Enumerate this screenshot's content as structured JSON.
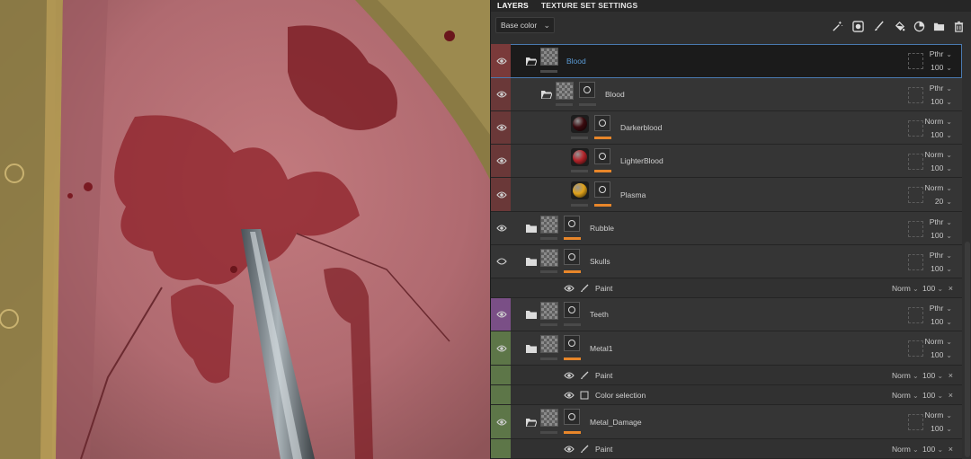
{
  "tabs": [
    "LAYERS",
    "TEXTURE SET SETTINGS"
  ],
  "toolbar": {
    "channel_select": "Base color",
    "icons": [
      "magic-wand-icon",
      "mask-icon",
      "brush-icon",
      "fill-icon",
      "smart-material-icon",
      "folder-icon",
      "trash-icon"
    ]
  },
  "colors": {
    "blood_group": "#7a3a3a",
    "blood_child": "#6a3838",
    "teeth": "#7a4f86",
    "metal": "#5d7648",
    "accent_orange": "#e8862a",
    "selection_text": "#5b9bd5"
  },
  "layers": [
    {
      "name": "Blood",
      "blend": "Pthr",
      "opacity": "100",
      "selected": true
    },
    {
      "name": "Blood",
      "blend": "Pthr",
      "opacity": "100"
    },
    {
      "name": "Darkerblood",
      "blend": "Norm",
      "opacity": "100"
    },
    {
      "name": "LighterBlood",
      "blend": "Norm",
      "opacity": "100"
    },
    {
      "name": "Plasma",
      "blend": "Norm",
      "opacity": "20"
    },
    {
      "name": "Rubble",
      "blend": "Pthr",
      "opacity": "100"
    },
    {
      "name": "Skulls",
      "blend": "Pthr",
      "opacity": "100"
    },
    {
      "name": "Paint",
      "blend": "Norm",
      "opacity": "100",
      "effect": true
    },
    {
      "name": "Teeth",
      "blend": "Pthr",
      "opacity": "100"
    },
    {
      "name": "Metal1",
      "blend": "Norm",
      "opacity": "100"
    },
    {
      "name": "Paint",
      "blend": "Norm",
      "opacity": "100",
      "effect": true
    },
    {
      "name": "Color selection",
      "blend": "Norm",
      "opacity": "100",
      "effect": true
    },
    {
      "name": "Metal_Damage",
      "blend": "Norm",
      "opacity": "100"
    },
    {
      "name": "Paint",
      "blend": "Norm",
      "opacity": "100",
      "effect": true
    }
  ]
}
